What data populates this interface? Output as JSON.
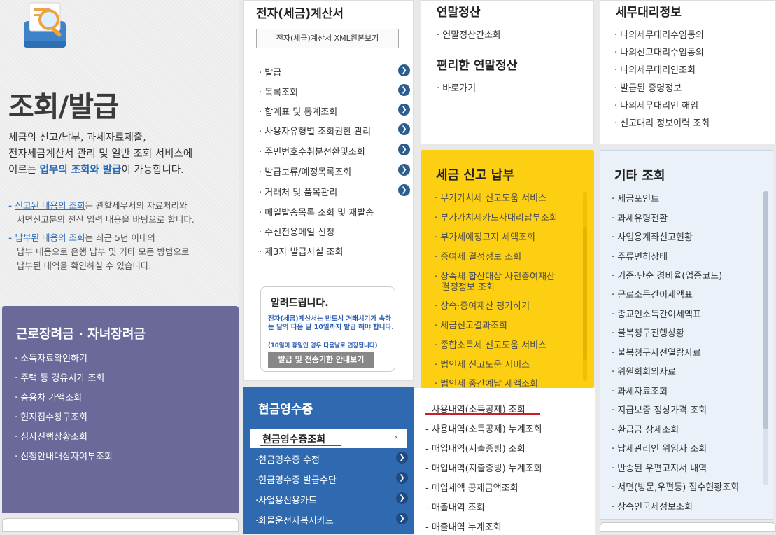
{
  "hero": {
    "title": "조회/발급",
    "desc_line1": "세금의 신고/납부, 과세자료제출,",
    "desc_line2": "전자세금계산서 관리 및 일반 조회 서비스에",
    "desc_line3_a": "이르는 ",
    "desc_line3_hl": "업무의 조회와 발급",
    "desc_line3_b": "이 가능합니다.",
    "note1_u": "신고된 내용의 조회",
    "note1_a": "는 관할세무서의 자료처리와",
    "note1_line2": "서면신고분의 전산 입력 내용을 바탕으로 합니다.",
    "note2_u": "납부된 내용의 조회",
    "note2_a": "는 최근 5년 이내의",
    "note2_line2": "납부 내용으로 은행 납부 및 기타 모든 방법으로",
    "note2_line3": "납부된 내역을 확인하실 수 있습니다."
  },
  "purple": {
    "title": "근로장려금 · 자녀장려금",
    "items": [
      "소득자료확인하기",
      "주택 등 경유시가 조회",
      "승용차 가액조회",
      "현지접수창구조회",
      "심사진행상황조회",
      "신청안내대상자여부조회"
    ]
  },
  "einvoice": {
    "title": "전자(세금)계산서",
    "xml_button": "전자(세금)계산서 XML원본보기",
    "items": [
      "발급",
      "목록조회",
      "합계표 및 통계조회",
      "사용자유형별 조회권한 관리",
      "주민번호수취분전환및조회",
      "발급보류/예정목록조회",
      "거래처 및 품목관리",
      "메일발송목록 조회 및 재발송",
      "수신전용메일 신청",
      "제3자 발급사실 조회"
    ],
    "notice": {
      "title": "알려드립니다.",
      "text": "전자(세금)계산서는 반드시 거래시기가 속하는 달의 다음 달 10일까지 발급 해야 합니다.",
      "sub": "(10일이 휴일인 경우 다음날로 연장됩니다)",
      "button": "발급 및 전송기한 안내보기"
    }
  },
  "cash": {
    "title": "현금영수증",
    "first": "현금영수증조회",
    "items": [
      "현금영수증 수정",
      "현금영수증 발급수단",
      "사업용신용카드",
      "화물운전자복지카드"
    ],
    "sublist": [
      "사용내역(소득공제) 조회",
      "사용내역(소득공제) 누계조회",
      "매입내역(지출증빙) 조회",
      "매입내역(지출증빙) 누계조회",
      "매입세액 공제금액조회",
      "매출내역 조회",
      "매출내역 누계조회"
    ]
  },
  "yearend": {
    "title": "연말정산",
    "item1": "연말정산간소화",
    "title2": "편리한 연말정산",
    "item2": "바로가기"
  },
  "taxreport": {
    "title": "세금 신고 납부",
    "items": [
      "부가가치세 신고도움 서비스",
      "부가가치세카드사대리납부조회",
      "부가세예정고지 세액조회",
      "증여세 결정정보 조회",
      "상속세 합산대상 사전증여재산",
      "결정정보 조회",
      "상속·증여재산 평가하기",
      "세금신고결과조회",
      "종합소득세 신고도움 서비스",
      "법인세 신고도움 서비스",
      "법인세 중간예납 세액조회"
    ]
  },
  "agent": {
    "title": "세무대리정보",
    "items": [
      "나의세무대리수임동의",
      "나의신고대리수임동의",
      "나의세무대리인조회",
      "발급된 증명정보",
      "나의세무대리인 해임",
      "신고대리 정보이력 조회"
    ]
  },
  "other": {
    "title": "기타 조회",
    "items": [
      "세금포인트",
      "과세유형전환",
      "사업용계좌신고현황",
      "주류면허상태",
      "기준·단순 경비율(업종코드)",
      "근로소득간이세액표",
      "종교인소득간이세액표",
      "불복청구진행상황",
      "불복청구사전열람자료",
      "위원회회의자료",
      "과세자료조회",
      "지급보증 정상가격 조회",
      "환급금 상세조회",
      "납세관리인 위임자 조회",
      "반송된 우편고지서 내역",
      "서면(방문,우편등) 접수현황조회",
      "상속인국세정보조회"
    ]
  }
}
